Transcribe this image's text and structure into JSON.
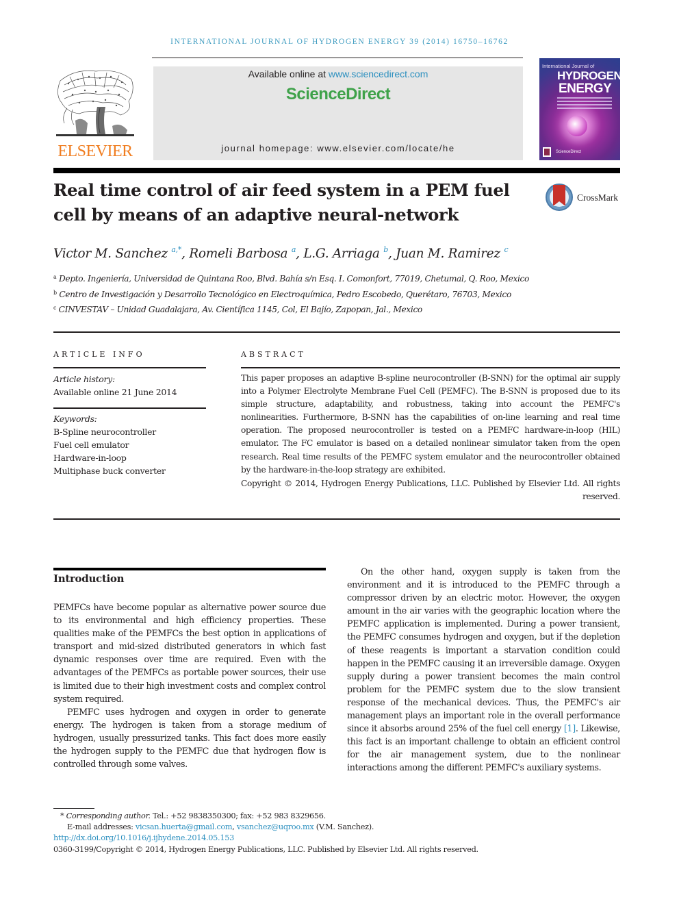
{
  "running_head": "International Journal of Hydrogen Energy 39 (2014) 16750–16762",
  "publisher": {
    "logo_text": "ELSEVIER",
    "available_online_prefix": "Available online at ",
    "available_online_link": "www.sciencedirect.com",
    "sciencedirect_logo": "ScienceDirect",
    "journal_homepage": "journal homepage: www.elsevier.com/locate/he"
  },
  "cover": {
    "line1": "International Journal of",
    "line2": "HYDROGEN",
    "line3": "ENERGY",
    "footer": "ScienceDirect"
  },
  "colors": {
    "link": "#2b8fbf",
    "elsevier_orange": "#f07d20",
    "sciencedirect_green": "#3fa24a",
    "header_box": "#e6e6e6"
  },
  "article": {
    "title": "Real time control of air feed system in a PEM fuel cell by means of an adaptive neural-network",
    "crossmark_label": "CrossMark",
    "authors": [
      {
        "name": "Victor M. Sanchez",
        "sup": "a,*",
        "sep": ", "
      },
      {
        "name": "Romeli Barbosa",
        "sup": "a",
        "sep": ", "
      },
      {
        "name": "L.G. Arriaga",
        "sup": "b",
        "sep": ", "
      },
      {
        "name": "Juan M. Ramirez",
        "sup": "c",
        "sep": ""
      }
    ],
    "affiliations": [
      {
        "mark": "a",
        "text": "Depto. Ingeniería, Universidad de Quintana Roo, Blvd. Bahía s/n Esq. I. Comonfort, 77019, Chetumal, Q. Roo, Mexico"
      },
      {
        "mark": "b",
        "text": "Centro de Investigación y Desarrollo Tecnológico en Electroquímica, Pedro Escobedo, Querétaro, 76703, Mexico"
      },
      {
        "mark": "c",
        "text": "CINVESTAV – Unidad Guadalajara, Av. Científica 1145, Col, El Bajío, Zapopan, Jal., Mexico"
      }
    ]
  },
  "article_info": {
    "heading": "ARTICLE INFO",
    "history_label": "Article history:",
    "history_value": "Available online 21 June 2014",
    "keywords_label": "Keywords:",
    "keywords": [
      "B-Spline neurocontroller",
      "Fuel cell emulator",
      "Hardware-in-loop",
      "Multiphase buck converter"
    ]
  },
  "abstract": {
    "heading": "ABSTRACT",
    "text": "This paper proposes an adaptive B-spline neurocontroller (B-SNN) for the optimal air supply into a Polymer Electrolyte Membrane Fuel Cell (PEMFC). The B-SNN is proposed due to its simple structure, adaptability, and robustness, taking into account the PEMFC's nonlinearities. Furthermore, B-SNN has the capabilities of on-line learning and real time operation. The proposed neurocontroller is tested on a PEMFC hardware-in-loop (HIL) emulator. The FC emulator is based on a detailed nonlinear simulator taken from the open research. Real time results of the PEMFC system emulator and the neurocontroller obtained by the hardware-in-the-loop strategy are exhibited.",
    "copyright": "Copyright © 2014, Hydrogen Energy Publications, LLC. Published by Elsevier Ltd. All rights reserved."
  },
  "introduction": {
    "heading": "Introduction",
    "left_paragraphs": [
      "PEMFCs have become popular as alternative power source due to its environmental and high efficiency properties. These qualities make of the PEMFCs the best option in applications of transport and mid-sized distributed generators in which fast dynamic responses over time are required. Even with the advantages of the PEMFCs as portable power sources, their use is limited due to their high investment costs and complex control system required.",
      "PEMFC uses hydrogen and oxygen in order to generate energy. The hydrogen is taken from a storage medium of hydrogen, usually pressurized tanks. This fact does more easily the hydrogen supply to the PEMFC due that hydrogen flow is controlled through some valves."
    ],
    "right_paragraph_before_ref": "On the other hand, oxygen supply is taken from the environment and it is introduced to the PEMFC through a compressor driven by an electric motor. However, the oxygen amount in the air varies with the geographic location where the PEMFC application is implemented. During a power transient, the PEMFC consumes hydrogen and oxygen, but if the depletion of these reagents is important a starvation condition could happen in the PEMFC causing it an irreversible damage. Oxygen supply during a power transient becomes the main control problem for the PEMFC system due to the slow transient response of the mechanical devices. Thus, the PEMFC's air management plays an important role in the overall performance since it absorbs around 25% of the fuel cell energy ",
    "right_ref": "[1]",
    "right_paragraph_after_ref": ". Likewise, this fact is an important challenge to obtain an efficient control for the air management system, due to the nonlinear interactions among the different PEMFC's auxiliary systems."
  },
  "footnotes": {
    "corresponding_mark": "*",
    "corresponding_label": "Corresponding author.",
    "contact": " Tel.: +52 9838350300; fax: +52 983 8329656.",
    "email_label": "E-mail addresses: ",
    "email1": "vicsan.huerta@gmail.com",
    "email_sep": ", ",
    "email2": "vsanchez@uqroo.mx",
    "email_owner": " (V.M. Sanchez).",
    "doi": "http://dx.doi.org/10.1016/j.ijhydene.2014.05.153",
    "issn_copyright": "0360-3199/Copyright © 2014, Hydrogen Energy Publications, LLC. Published by Elsevier Ltd. All rights reserved."
  }
}
